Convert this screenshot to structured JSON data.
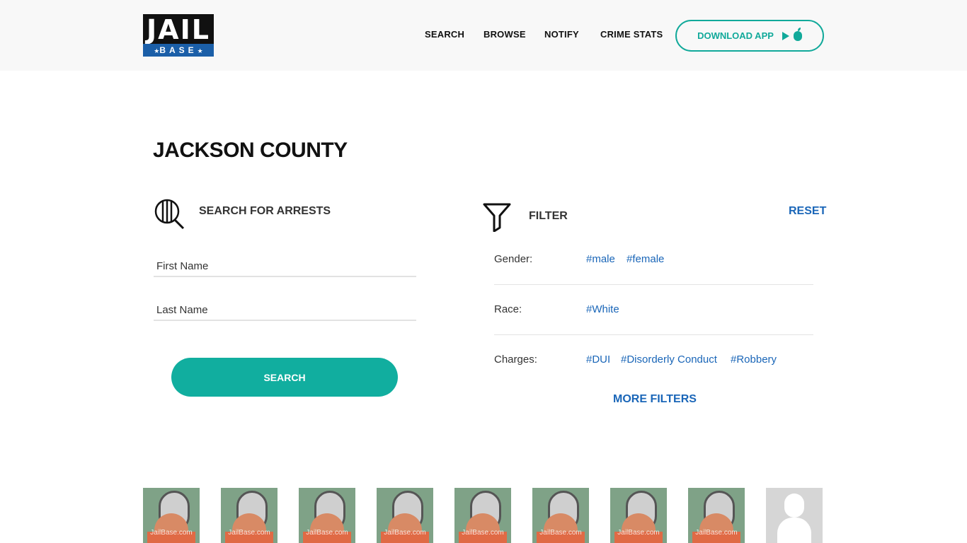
{
  "header": {
    "logo": {
      "top": "JAIL",
      "bottom": "BASE"
    },
    "nav": [
      {
        "label": "SEARCH"
      },
      {
        "label": "BROWSE"
      },
      {
        "label": "NOTIFY"
      },
      {
        "label": "CRIME STATS"
      }
    ],
    "download_label": "DOWNLOAD APP"
  },
  "page": {
    "title": "JACKSON COUNTY"
  },
  "search": {
    "heading": "SEARCH FOR ARRESTS",
    "first_name_placeholder": "First Name",
    "last_name_placeholder": "Last Name",
    "button_label": "SEARCH"
  },
  "filter": {
    "heading": "FILTER",
    "reset_label": "RESET",
    "gender_label": "Gender:",
    "gender_tags": [
      "#male",
      "#female"
    ],
    "race_label": "Race:",
    "race_tags": [
      "#White"
    ],
    "charges_label": "Charges:",
    "charges_tags": [
      "#DUI",
      "#Disorderly Conduct",
      "#Robbery"
    ],
    "more_label": "MORE FILTERS"
  },
  "thumbnails": {
    "watermark": "JailBase.com"
  },
  "colors": {
    "accent_teal": "#11ae9f",
    "link_blue": "#1a66b8",
    "logo_blue": "#1b5fa8"
  }
}
